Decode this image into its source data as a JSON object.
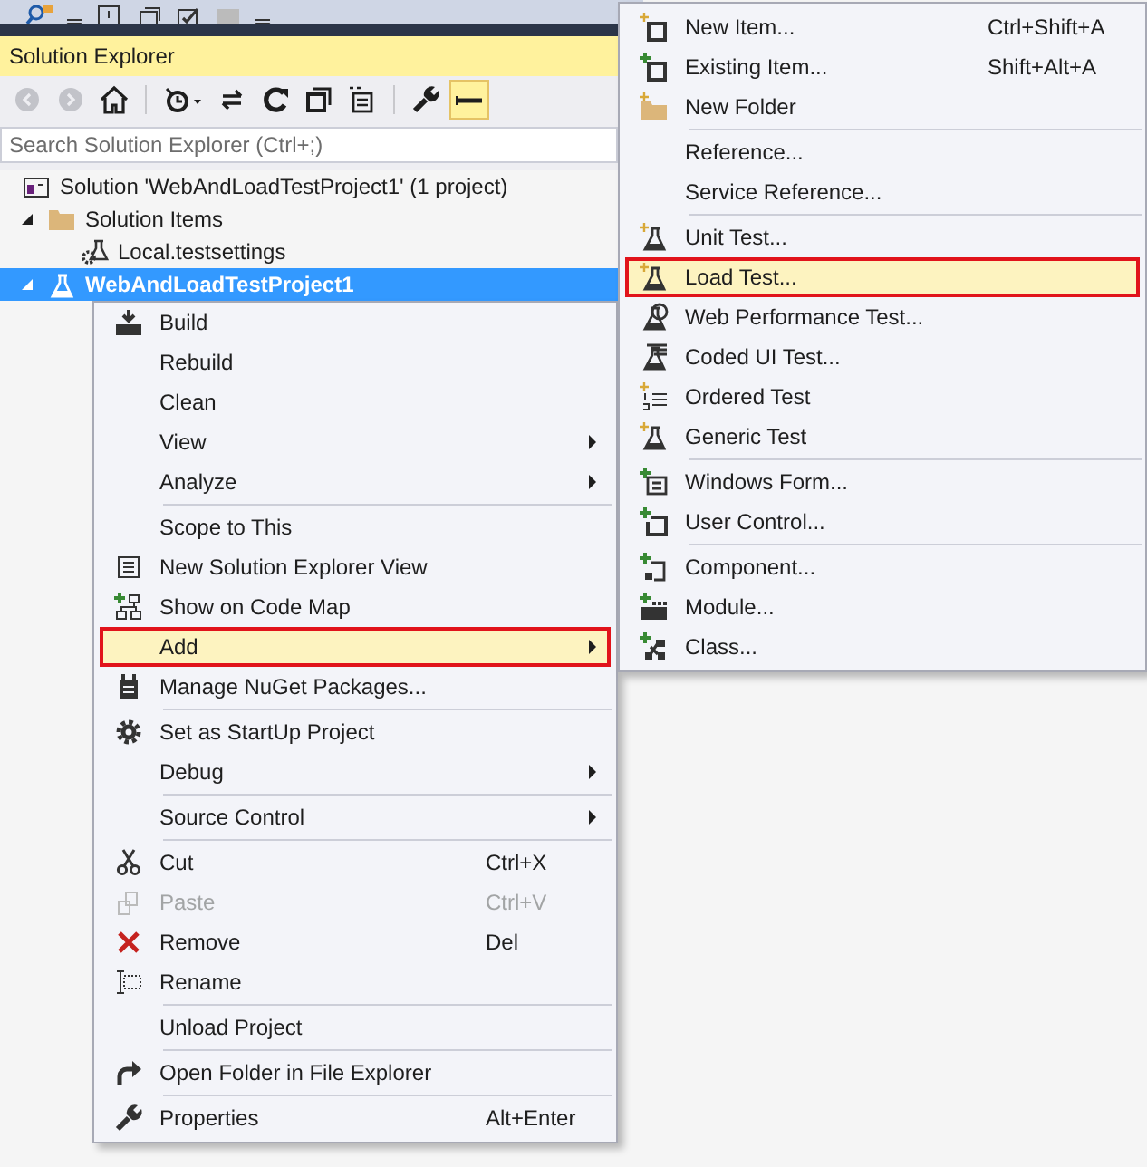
{
  "panel": {
    "title": "Solution Explorer",
    "toolbar": [
      {
        "kind": "button",
        "disabled": true,
        "selected": false
      },
      {
        "kind": "button",
        "disabled": true,
        "selected": false
      },
      {
        "kind": "button",
        "disabled": false,
        "selected": false
      },
      {
        "kind": "separator"
      },
      {
        "kind": "button",
        "disabled": false,
        "selected": false
      },
      {
        "kind": "button",
        "disabled": false,
        "selected": false
      },
      {
        "kind": "button",
        "disabled": false,
        "selected": false
      },
      {
        "kind": "button",
        "disabled": false,
        "selected": false
      },
      {
        "kind": "button",
        "disabled": false,
        "selected": false
      },
      {
        "kind": "separator"
      },
      {
        "kind": "button",
        "disabled": false,
        "selected": false
      },
      {
        "kind": "button",
        "disabled": false,
        "selected": true
      }
    ],
    "search": {
      "placeholder": "Search Solution Explorer (Ctrl+;)"
    },
    "tree": [
      {
        "label": "Solution 'WebAndLoadTestProject1' (1 project)",
        "selected": false,
        "children": [
          {
            "label": "Solution Items",
            "expanded": true,
            "selected": false,
            "children": [
              {
                "label": "Local.testsettings",
                "selected": false
              }
            ]
          },
          {
            "label": "WebAndLoadTestProject1",
            "expanded": true,
            "selected": true
          }
        ]
      }
    ]
  },
  "context_menu": {
    "groups": [
      [
        {
          "label": "Build",
          "selected": false,
          "disabled": false,
          "submenu": false
        },
        {
          "label": "Rebuild",
          "selected": false,
          "disabled": false,
          "submenu": false
        },
        {
          "label": "Clean",
          "selected": false,
          "disabled": false,
          "submenu": false
        },
        {
          "label": "View",
          "selected": false,
          "disabled": false,
          "submenu": true
        },
        {
          "label": "Analyze",
          "selected": false,
          "disabled": false,
          "submenu": true
        }
      ],
      [
        {
          "label": "Scope to This",
          "selected": false,
          "disabled": false,
          "submenu": false
        },
        {
          "label": "New Solution Explorer View",
          "selected": false,
          "disabled": false,
          "submenu": false
        },
        {
          "label": "Show on Code Map",
          "selected": false,
          "disabled": false,
          "submenu": false
        },
        {
          "label": "Add",
          "selected": true,
          "disabled": false,
          "submenu": true
        },
        {
          "label": "Manage NuGet Packages...",
          "selected": false,
          "disabled": false,
          "submenu": false
        }
      ],
      [
        {
          "label": "Set as StartUp Project",
          "selected": false,
          "disabled": false,
          "submenu": false
        },
        {
          "label": "Debug",
          "selected": false,
          "disabled": false,
          "submenu": true
        }
      ],
      [
        {
          "label": "Source Control",
          "selected": false,
          "disabled": false,
          "submenu": true
        }
      ],
      [
        {
          "label": "Cut",
          "shortcut": "Ctrl+X",
          "selected": false,
          "disabled": false,
          "submenu": false
        },
        {
          "label": "Paste",
          "shortcut": "Ctrl+V",
          "selected": false,
          "disabled": true,
          "submenu": false
        },
        {
          "label": "Remove",
          "shortcut": "Del",
          "selected": false,
          "disabled": false,
          "submenu": false
        },
        {
          "label": "Rename",
          "selected": false,
          "disabled": false,
          "submenu": false
        }
      ],
      [
        {
          "label": "Unload Project",
          "selected": false,
          "disabled": false,
          "submenu": false
        }
      ],
      [
        {
          "label": "Open Folder in File Explorer",
          "selected": false,
          "disabled": false,
          "submenu": false
        }
      ],
      [
        {
          "label": "Properties",
          "shortcut": "Alt+Enter",
          "selected": false,
          "disabled": false,
          "submenu": false
        }
      ]
    ]
  },
  "add_submenu": {
    "groups": [
      [
        {
          "label": "New Item...",
          "shortcut": "Ctrl+Shift+A",
          "selected": false
        },
        {
          "label": "Existing Item...",
          "shortcut": "Shift+Alt+A",
          "selected": false
        },
        {
          "label": "New Folder",
          "selected": false
        }
      ],
      [
        {
          "label": "Reference...",
          "selected": false
        },
        {
          "label": "Service Reference...",
          "selected": false
        }
      ],
      [
        {
          "label": "Unit Test...",
          "selected": false
        },
        {
          "label": "Load Test...",
          "selected": true
        },
        {
          "label": "Web Performance Test...",
          "selected": false
        },
        {
          "label": "Coded UI Test...",
          "selected": false
        },
        {
          "label": "Ordered Test",
          "selected": false
        },
        {
          "label": "Generic Test",
          "selected": false
        }
      ],
      [
        {
          "label": "Windows Form...",
          "selected": false
        },
        {
          "label": "User Control...",
          "selected": false
        }
      ],
      [
        {
          "label": "Component...",
          "selected": false
        },
        {
          "label": "Module...",
          "selected": false
        },
        {
          "label": "Class...",
          "selected": false
        }
      ]
    ]
  }
}
